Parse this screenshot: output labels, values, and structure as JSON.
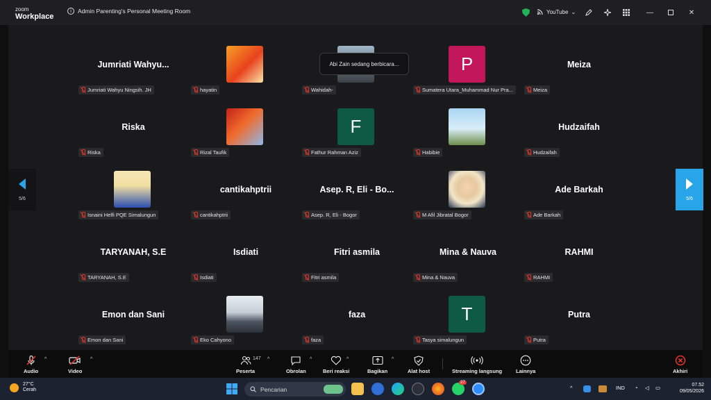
{
  "titlebar": {
    "brand_line1": "zoom",
    "brand_line2": "Workplace",
    "meeting_title": "Admin Parenting's Personal Meeting Room",
    "stream_label": "YouTube",
    "security_color": "#22b35a"
  },
  "toast": {
    "text": "Abi Zain sedang berbicara..."
  },
  "navigation": {
    "left_page": "5/6",
    "right_page": "5/6",
    "accent": "#27a5e8"
  },
  "participants": [
    {
      "display": "Jumriati  Wahyu...",
      "tag": "Jumriati Wahyu Ningsih. JH",
      "avatar": "none"
    },
    {
      "display": "",
      "tag": "hayatin",
      "avatar": "photo-orange-poster"
    },
    {
      "display": "",
      "tag": "Wahidah-",
      "avatar": "photo-road"
    },
    {
      "display": "",
      "tag": "Sumatera Utara_Muhammad Nur Pra...",
      "avatar": "letter",
      "letter": "P",
      "color": "#c2185b"
    },
    {
      "display": "Meiza",
      "tag": "Meiza",
      "avatar": "none"
    },
    {
      "display": "Riska",
      "tag": "Riska",
      "avatar": "none"
    },
    {
      "display": "",
      "tag": "Rizal Taufik",
      "avatar": "photo-red-festive"
    },
    {
      "display": "",
      "tag": "Fathur Rahman Aziz",
      "avatar": "letter",
      "letter": "F",
      "color": "#0e5a45"
    },
    {
      "display": "",
      "tag": "Habibie",
      "avatar": "photo-sky"
    },
    {
      "display": "Hudzaifah",
      "tag": "Hudzaifah",
      "avatar": "none"
    },
    {
      "display": "",
      "tag": "Isnaini Helfi PQE Simalungun",
      "avatar": "photo-blue-person"
    },
    {
      "display": "cantikahptrii",
      "tag": "cantikahptrii",
      "avatar": "none"
    },
    {
      "display": "Asep. R, Eli - Bo...",
      "tag": "Asep. R, Eli - Bogor",
      "avatar": "none"
    },
    {
      "display": "",
      "tag": "M Afil Jibratal Bogor",
      "avatar": "photo-anime"
    },
    {
      "display": "Ade Barkah",
      "tag": "Ade Barkah",
      "avatar": "none"
    },
    {
      "display": "TARYANAH, S.E",
      "tag": "TARYANAH, S.E",
      "avatar": "none"
    },
    {
      "display": "Isdiati",
      "tag": "Isdiati",
      "avatar": "none"
    },
    {
      "display": "Fitri asmila",
      "tag": "Fitri asmila",
      "avatar": "none"
    },
    {
      "display": "Mina & Nauva",
      "tag": "Mina & Nauva",
      "avatar": "none"
    },
    {
      "display": "RAHMI",
      "tag": "RAHMI",
      "avatar": "none"
    },
    {
      "display": "Emon dan Sani",
      "tag": "Emon dan Sani",
      "avatar": "none"
    },
    {
      "display": "",
      "tag": "Eko Cahyono",
      "avatar": "photo-building"
    },
    {
      "display": "faza",
      "tag": "faza",
      "avatar": "none"
    },
    {
      "display": "",
      "tag": "Tasya simalungun",
      "avatar": "letter",
      "letter": "T",
      "color": "#0e5a45"
    },
    {
      "display": "Putra",
      "tag": "Putra",
      "avatar": "none"
    }
  ],
  "toolbar": {
    "audio": "Audio",
    "video": "Video",
    "participants_label": "Peserta",
    "participants_count": "147",
    "chat": "Obrolan",
    "react": "Beri reaksi",
    "share": "Bagikan",
    "host_tools": "Alat host",
    "streaming": "Streaming langsung",
    "more": "Lainnya",
    "end": "Akhiri",
    "end_color": "#e0352b"
  },
  "taskbar": {
    "weather_temp": "27°C",
    "weather_desc": "Cerah",
    "search_placeholder": "Pencarian",
    "whatsapp_badge": "27",
    "lang": "IND",
    "time": "07.52",
    "date": "09/05/2026"
  }
}
